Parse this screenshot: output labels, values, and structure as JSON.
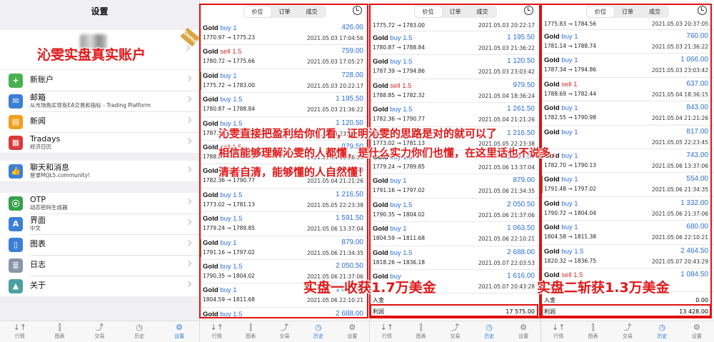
{
  "settings": {
    "title": "设置",
    "account_badge": "Demo",
    "overlay_headline": "沁雯实盘真实账户",
    "items_group1": [
      {
        "label": "新账户",
        "sub": "",
        "icon": "add-user-icon",
        "color": "#4caf50",
        "glyph": "+"
      },
      {
        "label": "邮箱",
        "sub": "从市场购买现有EA交易和指标 - Trading Platform",
        "icon": "mail-icon",
        "color": "#3d7fd6",
        "glyph": "✉"
      },
      {
        "label": "新闻",
        "sub": "",
        "icon": "news-icon",
        "color": "#f0a020",
        "glyph": "▤"
      },
      {
        "label": "Tradays",
        "sub": "经济日历",
        "icon": "tradays-icon",
        "color": "#d83a3a",
        "glyph": "▦"
      }
    ],
    "items_group2": [
      {
        "label": "聊天和消息",
        "sub": "登录MQL5.community!",
        "icon": "chat-icon",
        "color": "#3d7fd6",
        "glyph": "👍"
      }
    ],
    "items_group3": [
      {
        "label": "OTP",
        "sub": "动态密码生成器",
        "icon": "otp-icon",
        "color": "#38a04a",
        "glyph": "⦿"
      },
      {
        "label": "界面",
        "sub": "中文",
        "icon": "language-icon",
        "color": "#3d7fd6",
        "glyph": "A"
      },
      {
        "label": "图表",
        "sub": "",
        "icon": "chart-icon",
        "color": "#3d7fd6",
        "glyph": "▯"
      },
      {
        "label": "日志",
        "sub": "",
        "icon": "log-icon",
        "color": "#8a96a8",
        "glyph": "≣"
      },
      {
        "label": "关于",
        "sub": "",
        "icon": "about-icon",
        "color": "#4aa0a0",
        "glyph": "▲"
      }
    ]
  },
  "tabs": [
    {
      "label": "行情",
      "icon": "quotes-icon",
      "glyph": "↓↑"
    },
    {
      "label": "图表",
      "icon": "chart-tab-icon",
      "glyph": "⫿"
    },
    {
      "label": "交易",
      "icon": "trade-icon",
      "glyph": "⤴"
    },
    {
      "label": "历史",
      "icon": "history-icon",
      "glyph": "◷"
    },
    {
      "label": "设置",
      "icon": "settings-icon",
      "glyph": "⚙"
    }
  ],
  "history_segments": [
    "价位",
    "订单",
    "成交"
  ],
  "panel1": {
    "trades": [
      {
        "sym": "Gold",
        "side": "buy",
        "vol": "1",
        "prices": "1770.97 → 1775.23",
        "profit": "426.00",
        "date": "2021.05.03 17:04:56",
        "bar": false
      },
      {
        "sym": "Gold",
        "side": "sell",
        "vol": "1.5",
        "prices": "1780.72 → 1775.66",
        "profit": "759.00",
        "date": "2021.05.03 17:05:27",
        "bar": false
      },
      {
        "sym": "Gold",
        "side": "buy",
        "vol": "1",
        "prices": "1775.72 → 1783.00",
        "profit": "728.00",
        "date": "2021.05.03 20:22:17",
        "bar": true
      },
      {
        "sym": "Gold",
        "side": "buy",
        "vol": "1.5",
        "prices": "1780.87 → 1788.84",
        "profit": "1 195.50",
        "date": "2021.05.03 21:36:22",
        "bar": false
      },
      {
        "sym": "Gold",
        "side": "buy",
        "vol": "1.5",
        "prices": "1787.39 → 1794.86",
        "profit": "1 120.50",
        "date": "2021.05.03 23:03:42",
        "bar": false
      },
      {
        "sym": "Gold",
        "side": "sell",
        "vol": "1.5",
        "prices": "1788.85 → 1782.32",
        "profit": "979.50",
        "date": "2021.05.04 18:36:24",
        "bar": false
      },
      {
        "sym": "Gold",
        "side": "buy",
        "vol": "1.5",
        "prices": "1782.36 → 1790.77",
        "profit": "1 261.50",
        "date": "2021.05.04 21:21:26",
        "bar": false
      },
      {
        "sym": "Gold",
        "side": "buy",
        "vol": "1.5",
        "prices": "1773.02 → 1781.13",
        "profit": "1 216.50",
        "date": "2021.05.05 22:23:38",
        "bar": false
      },
      {
        "sym": "Gold",
        "side": "buy",
        "vol": "1.5",
        "prices": "1779.24 → 1789.85",
        "profit": "1 591.50",
        "date": "2021.05.06 13:37:04",
        "bar": false
      },
      {
        "sym": "Gold",
        "side": "buy",
        "vol": "1",
        "prices": "1791.16 → 1797.02",
        "profit": "879.00",
        "date": "2021.05.06 21:34:35",
        "bar": true
      },
      {
        "sym": "Gold",
        "side": "buy",
        "vol": "1.5",
        "prices": "1790.35 → 1804.02",
        "profit": "2 050.50",
        "date": "2021.05.06 21:37:06",
        "bar": false
      },
      {
        "sym": "Gold",
        "side": "buy",
        "vol": "1",
        "prices": "1804.59 → 1811.68",
        "profit": "1 063.50",
        "date": "2021.05.06 22:10:21",
        "bar": false
      },
      {
        "sym": "Gold",
        "side": "buy",
        "vol": "1.5",
        "prices": "",
        "profit": "2 688.00",
        "date": "",
        "bar": false
      }
    ]
  },
  "panel2": {
    "top_prices": "1775.72 → 1783.00",
    "top_date": "2021.05.03 20:22:17",
    "trades": [
      {
        "sym": "Gold",
        "side": "buy",
        "vol": "1.5",
        "prices": "1780.87 → 1788.84",
        "profit": "1 195.50",
        "date": "2021.05.03 21:36:22",
        "bar": false
      },
      {
        "sym": "Gold",
        "side": "buy",
        "vol": "1.5",
        "prices": "1787.39 → 1794.86",
        "profit": "1 120.50",
        "date": "2021.05.03 23:03:42",
        "bar": false
      },
      {
        "sym": "Gold",
        "side": "sell",
        "vol": "1.5",
        "prices": "1788.85 → 1782.32",
        "profit": "979.50",
        "date": "2021.05.04 18:36:24",
        "bar": false
      },
      {
        "sym": "Gold",
        "side": "buy",
        "vol": "1.5",
        "prices": "1782.36 → 1790.77",
        "profit": "1 261.50",
        "date": "2021.05.04 21:21:26",
        "bar": false
      },
      {
        "sym": "Gold",
        "side": "buy",
        "vol": "1.5",
        "prices": "1773.02 → 1781.13",
        "profit": "1 216.50",
        "date": "2021.05.05 22:23:38",
        "bar": false
      },
      {
        "sym": "Gold",
        "side": "buy",
        "vol": "1.5",
        "prices": "1779.24 → 1789.85",
        "profit": "1 591.50",
        "date": "2021.05.06 13:37:04",
        "bar": false
      },
      {
        "sym": "Gold",
        "side": "buy",
        "vol": "1",
        "prices": "1791.16 → 1797.02",
        "profit": "879.00",
        "date": "2021.05.06 21:34:35",
        "bar": false
      },
      {
        "sym": "Gold",
        "side": "buy",
        "vol": "1.5",
        "prices": "1790.35 → 1804.02",
        "profit": "2 050.50",
        "date": "2021.05.06 21:37:06",
        "bar": false
      },
      {
        "sym": "Gold",
        "side": "buy",
        "vol": "1",
        "prices": "1804.59 → 1811.68",
        "profit": "1 063.50",
        "date": "2021.05.06 22:10:21",
        "bar": false
      },
      {
        "sym": "Gold",
        "side": "buy",
        "vol": "1.5",
        "prices": "1818.26 → 1836.18",
        "profit": "2 688.00",
        "date": "2021.05.07 22:03:53",
        "bar": false
      },
      {
        "sym": "Gold",
        "side": "buy",
        "vol": "",
        "prices": "",
        "profit": "1 616.00",
        "date": "2021.05.07 20:43:28",
        "bar": false
      }
    ],
    "deposit_label": "入金",
    "profit_label": "利润",
    "profit_value": "17 575.00",
    "overlay": "实盘一收获1.7万美金"
  },
  "panel3": {
    "top_prices": "1775.83 → 1784.56",
    "top_date": "2021.05.03 20:37:05",
    "trades": [
      {
        "sym": "Gold",
        "side": "buy",
        "vol": "1",
        "prices": "1781.14 → 1788.74",
        "profit": "760.00",
        "date": "2021.05.03 21:36:22",
        "bar": false
      },
      {
        "sym": "Gold",
        "side": "buy",
        "vol": "1",
        "prices": "1787.34 → 1794.86",
        "profit": "1 066.00",
        "date": "2021.05.03 23:03:42",
        "bar": false
      },
      {
        "sym": "Gold",
        "side": "sell",
        "vol": "1",
        "prices": "1788.69 → 1782.44",
        "profit": "637.00",
        "date": "2021.05.04 18:36:15",
        "bar": false
      },
      {
        "sym": "Gold",
        "side": "buy",
        "vol": "1",
        "prices": "1782.55 → 1790.98",
        "profit": "843.00",
        "date": "2021.05.04 21:21:26",
        "bar": false
      },
      {
        "sym": "Gold",
        "side": "buy",
        "vol": "1",
        "prices": "",
        "profit": "817.00",
        "date": "2021.05.05 22:23:45",
        "bar": false
      },
      {
        "sym": "Gold",
        "side": "buy",
        "vol": "1",
        "prices": "1782.70 → 1790.13",
        "profit": "743.00",
        "date": "2021.05.06 13:37:06",
        "bar": false
      },
      {
        "sym": "Gold",
        "side": "buy",
        "vol": "1",
        "prices": "1791.48 → 1797.02",
        "profit": "554.00",
        "date": "2021.05.06 21:34:35",
        "bar": true
      },
      {
        "sym": "Gold",
        "side": "buy",
        "vol": "1",
        "prices": "1790.72 → 1804.04",
        "profit": "1 332.00",
        "date": "2021.05.06 21:37:06",
        "bar": false
      },
      {
        "sym": "Gold",
        "side": "buy",
        "vol": "1",
        "prices": "1804.58 → 1811.38",
        "profit": "680.00",
        "date": "2021.05.06 22:10:21",
        "bar": false
      },
      {
        "sym": "Gold",
        "side": "buy",
        "vol": "1.5",
        "prices": "1820.32 → 1836.75",
        "profit": "2 464.50",
        "date": "2021.05.07 20:43:29",
        "bar": false
      },
      {
        "sym": "Gold",
        "side": "sell",
        "vol": "1.5",
        "prices": "",
        "profit": "1 084.50",
        "date": "",
        "bar": false
      }
    ],
    "deposit_label": "入金",
    "deposit_value": "0.00",
    "profit_label": "利润",
    "profit_value": "13 428.00",
    "overlay": "实盘二斩获1.3万美金"
  },
  "overlay_middle": [
    "沁雯直接把盈利给你们看，证明沁雯的思路是对的就可以了",
    "相信能够理解沁雯的人都懂，是什么实力你们也懂，在这里话也不说多，",
    "清者自清，能够懂的人自然懂！"
  ],
  "colors": {
    "overlay_red": "#e01818",
    "buy_blue": "#2b6fd8",
    "sell_red": "#d42a2a",
    "active_tab_blue": "#2b7de1"
  }
}
